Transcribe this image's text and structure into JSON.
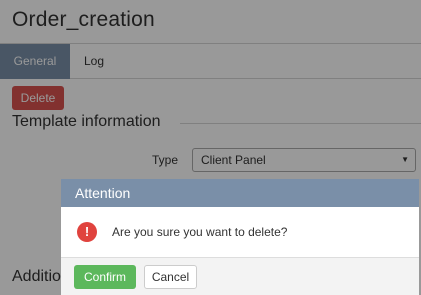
{
  "page": {
    "title": "Order_creation"
  },
  "tabs": [
    {
      "label": "General",
      "active": true
    },
    {
      "label": "Log",
      "active": false
    }
  ],
  "actions": {
    "delete_label": "Delete"
  },
  "template_section": {
    "title": "Template information",
    "type_label": "Type",
    "type_value": "Client Panel"
  },
  "additional_section": {
    "title": "Additio"
  },
  "dialog": {
    "title": "Attention",
    "message": "Are you sure you want to delete?",
    "icon": "exclamation-circle-icon",
    "icon_glyph": "!",
    "confirm_label": "Confirm",
    "cancel_label": "Cancel"
  },
  "colors": {
    "header_accent": "#7a8fa8",
    "danger": "#d9534f",
    "success": "#5cb85c",
    "alert_icon": "#e0433e"
  }
}
